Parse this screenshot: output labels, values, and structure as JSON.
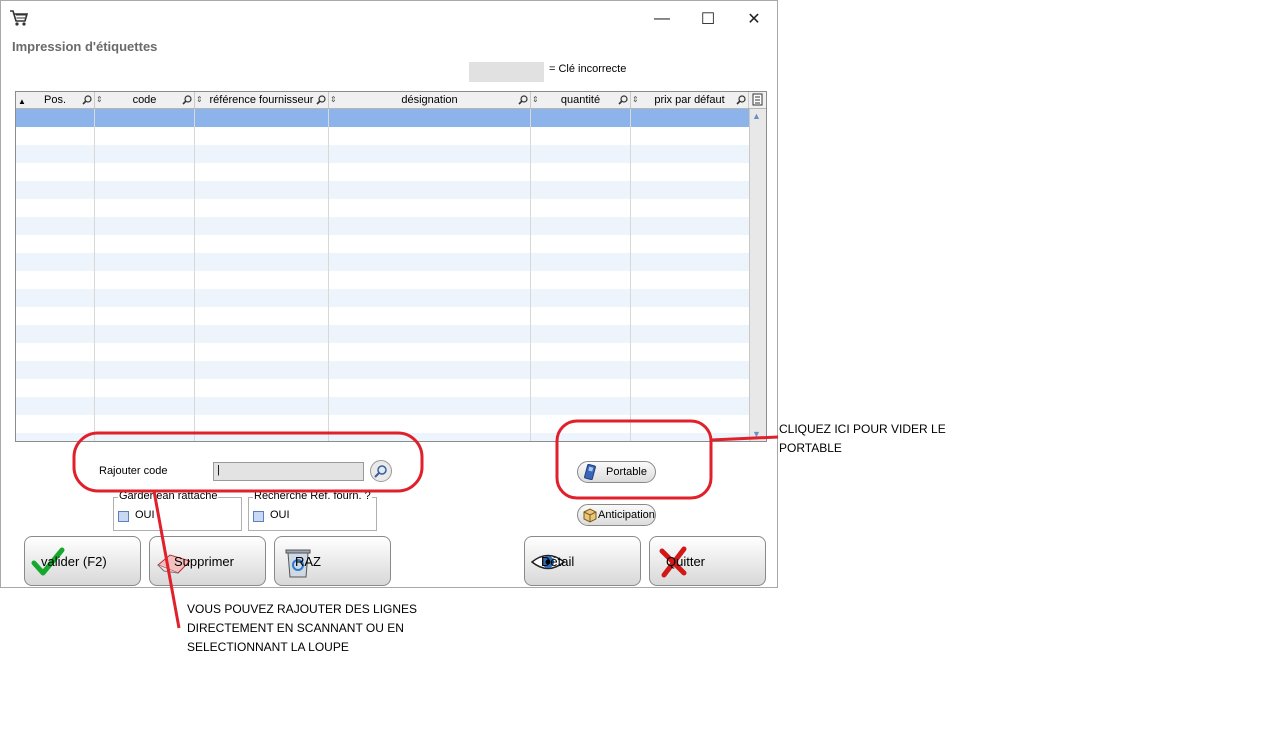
{
  "window": {
    "title": "Impression d'étiquettes",
    "controls": {
      "minimize": "—",
      "maximize": "☐",
      "close": "✕"
    }
  },
  "legend": {
    "text": "= Clé incorrecte",
    "swatch_color": "#e1e1e1"
  },
  "grid": {
    "columns": [
      {
        "label": "Pos."
      },
      {
        "label": "code"
      },
      {
        "label": "référence fournisseur"
      },
      {
        "label": "désignation"
      },
      {
        "label": "quantité"
      },
      {
        "label": "prix par défaut"
      }
    ],
    "selected_row_color": "#8cb4ea",
    "alt_row_color": "#eef4fc"
  },
  "add_code": {
    "label": "Rajouter code",
    "value": "|"
  },
  "options": {
    "garder": {
      "title": "Garder ean rattaché",
      "checkbox_label": "OUI"
    },
    "recherche": {
      "title": "Recherche Réf. fourn. ?",
      "checkbox_label": "OUI"
    }
  },
  "small_buttons": {
    "portable": "Portable",
    "anticipation": "Anticipation"
  },
  "buttons": {
    "valider": "valider (F2)",
    "supprimer": "Supprimer",
    "raz": "RAZ",
    "detail": "Détail",
    "quitter": "Quitter"
  },
  "annotations": {
    "right_line1": "CLIQUEZ ICI POUR VIDER LE",
    "right_line2": "PORTABLE",
    "bottom_line1": "VOUS POUVEZ RAJOUTER DES LIGNES",
    "bottom_line2": "DIRECTEMENT EN SCANNANT OU EN",
    "bottom_line3": "SELECTIONNANT LA LOUPE",
    "color": "#e0202a"
  }
}
